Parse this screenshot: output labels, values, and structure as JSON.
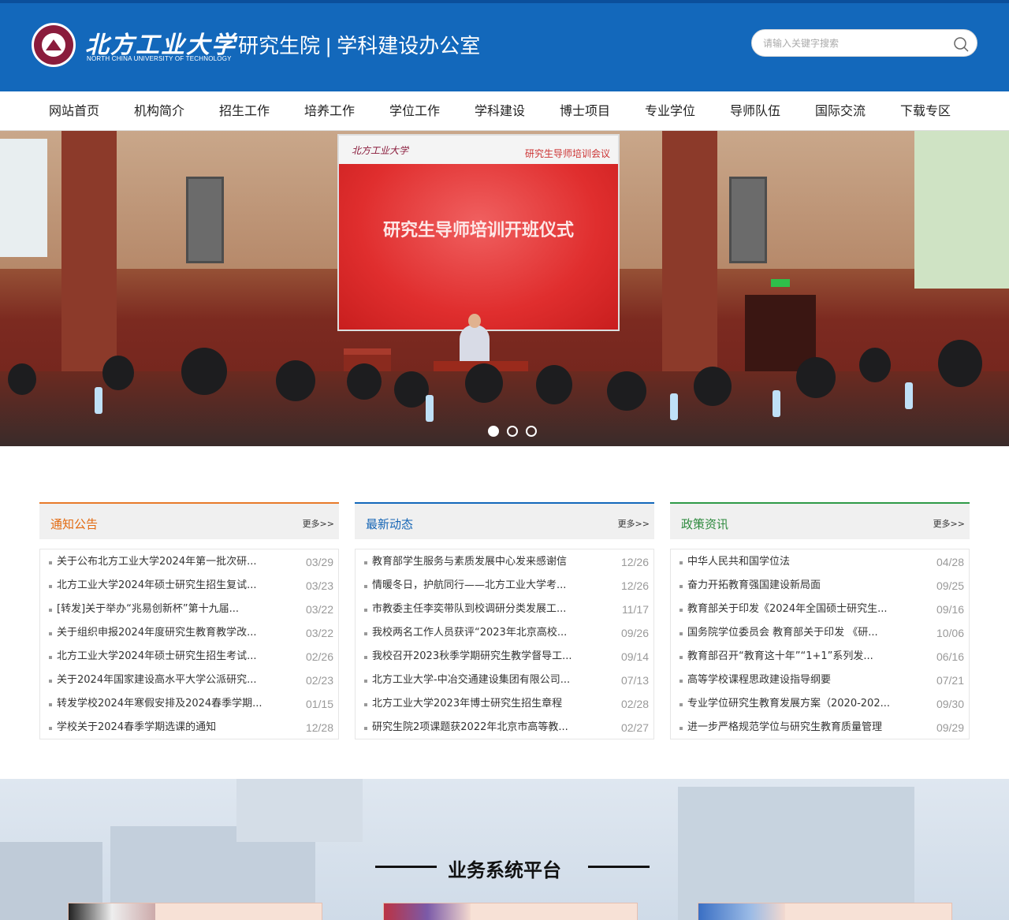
{
  "header": {
    "university_name": "北方工业大学",
    "university_en": "NORTH CHINA UNIVERSITY OF TECHNOLOGY",
    "site_title": "研究生院 | 学科建设办公室",
    "search_placeholder": "请输入关键字搜索",
    "brand_color": "#1368bb"
  },
  "nav": {
    "items": [
      "网站首页",
      "机构简介",
      "招生工作",
      "培养工作",
      "学位工作",
      "学科建设",
      "博士项目",
      "专业学位",
      "导师队伍",
      "国际交流",
      "下载专区"
    ]
  },
  "banner": {
    "screen_logo": "北方工业大学",
    "screen_subtitle": "研究生导师培训会议",
    "screen_title": "研究生导师培训开班仪式",
    "active_slide": 1,
    "slide_count": 3
  },
  "news": {
    "notices": {
      "title": "通知公告",
      "more": "更多>>",
      "items": [
        {
          "text": "关于公布北方工业大学2024年第一批次研...",
          "date": "03/29"
        },
        {
          "text": "北方工业大学2024年硕士研究生招生复试...",
          "date": "03/23"
        },
        {
          "text": "[转发]关于举办“兆易创新杯”第十九届...",
          "date": "03/22"
        },
        {
          "text": "关于组织申报2024年度研究生教育教学改...",
          "date": "03/22"
        },
        {
          "text": "北方工业大学2024年硕士研究生招生考试...",
          "date": "02/26"
        },
        {
          "text": "关于2024年国家建设高水平大学公派研究...",
          "date": "02/23"
        },
        {
          "text": "转发学校2024年寒假安排及2024春季学期...",
          "date": "01/15"
        },
        {
          "text": "学校关于2024春季学期选课的通知",
          "date": "12/28"
        }
      ]
    },
    "updates": {
      "title": "最新动态",
      "more": "更多>>",
      "items": [
        {
          "text": "教育部学生服务与素质发展中心发来感谢信",
          "date": "12/26"
        },
        {
          "text": "情暖冬日，护航同行——北方工业大学考...",
          "date": "12/26"
        },
        {
          "text": "市教委主任李奕带队到校调研分类发展工...",
          "date": "11/17"
        },
        {
          "text": "我校两名工作人员获评“2023年北京高校...",
          "date": "09/26"
        },
        {
          "text": "我校召开2023秋季学期研究生教学督导工...",
          "date": "09/14"
        },
        {
          "text": "北方工业大学-中冶交通建设集团有限公司...",
          "date": "07/13"
        },
        {
          "text": "北方工业大学2023年博士研究生招生章程",
          "date": "02/28"
        },
        {
          "text": "研究生院2项课题获2022年北京市高等教...",
          "date": "02/27"
        }
      ]
    },
    "policy": {
      "title": "政策资讯",
      "more": "更多>>",
      "items": [
        {
          "text": "中华人民共和国学位法",
          "date": "04/28"
        },
        {
          "text": "奋力开拓教育强国建设新局面",
          "date": "09/25"
        },
        {
          "text": "教育部关于印发《2024年全国硕士研究生...",
          "date": "09/16"
        },
        {
          "text": "国务院学位委员会 教育部关于印发 《研...",
          "date": "10/06"
        },
        {
          "text": "教育部召开“教育这十年”“1+1”系列发...",
          "date": "06/16"
        },
        {
          "text": "高等学校课程思政建设指导纲要",
          "date": "07/21"
        },
        {
          "text": "专业学位研究生教育发展方案（2020-202...",
          "date": "09/30"
        },
        {
          "text": "进一步严格规范学位与研究生教育质量管理",
          "date": "09/29"
        }
      ]
    }
  },
  "business": {
    "title": "业务系统平台"
  }
}
